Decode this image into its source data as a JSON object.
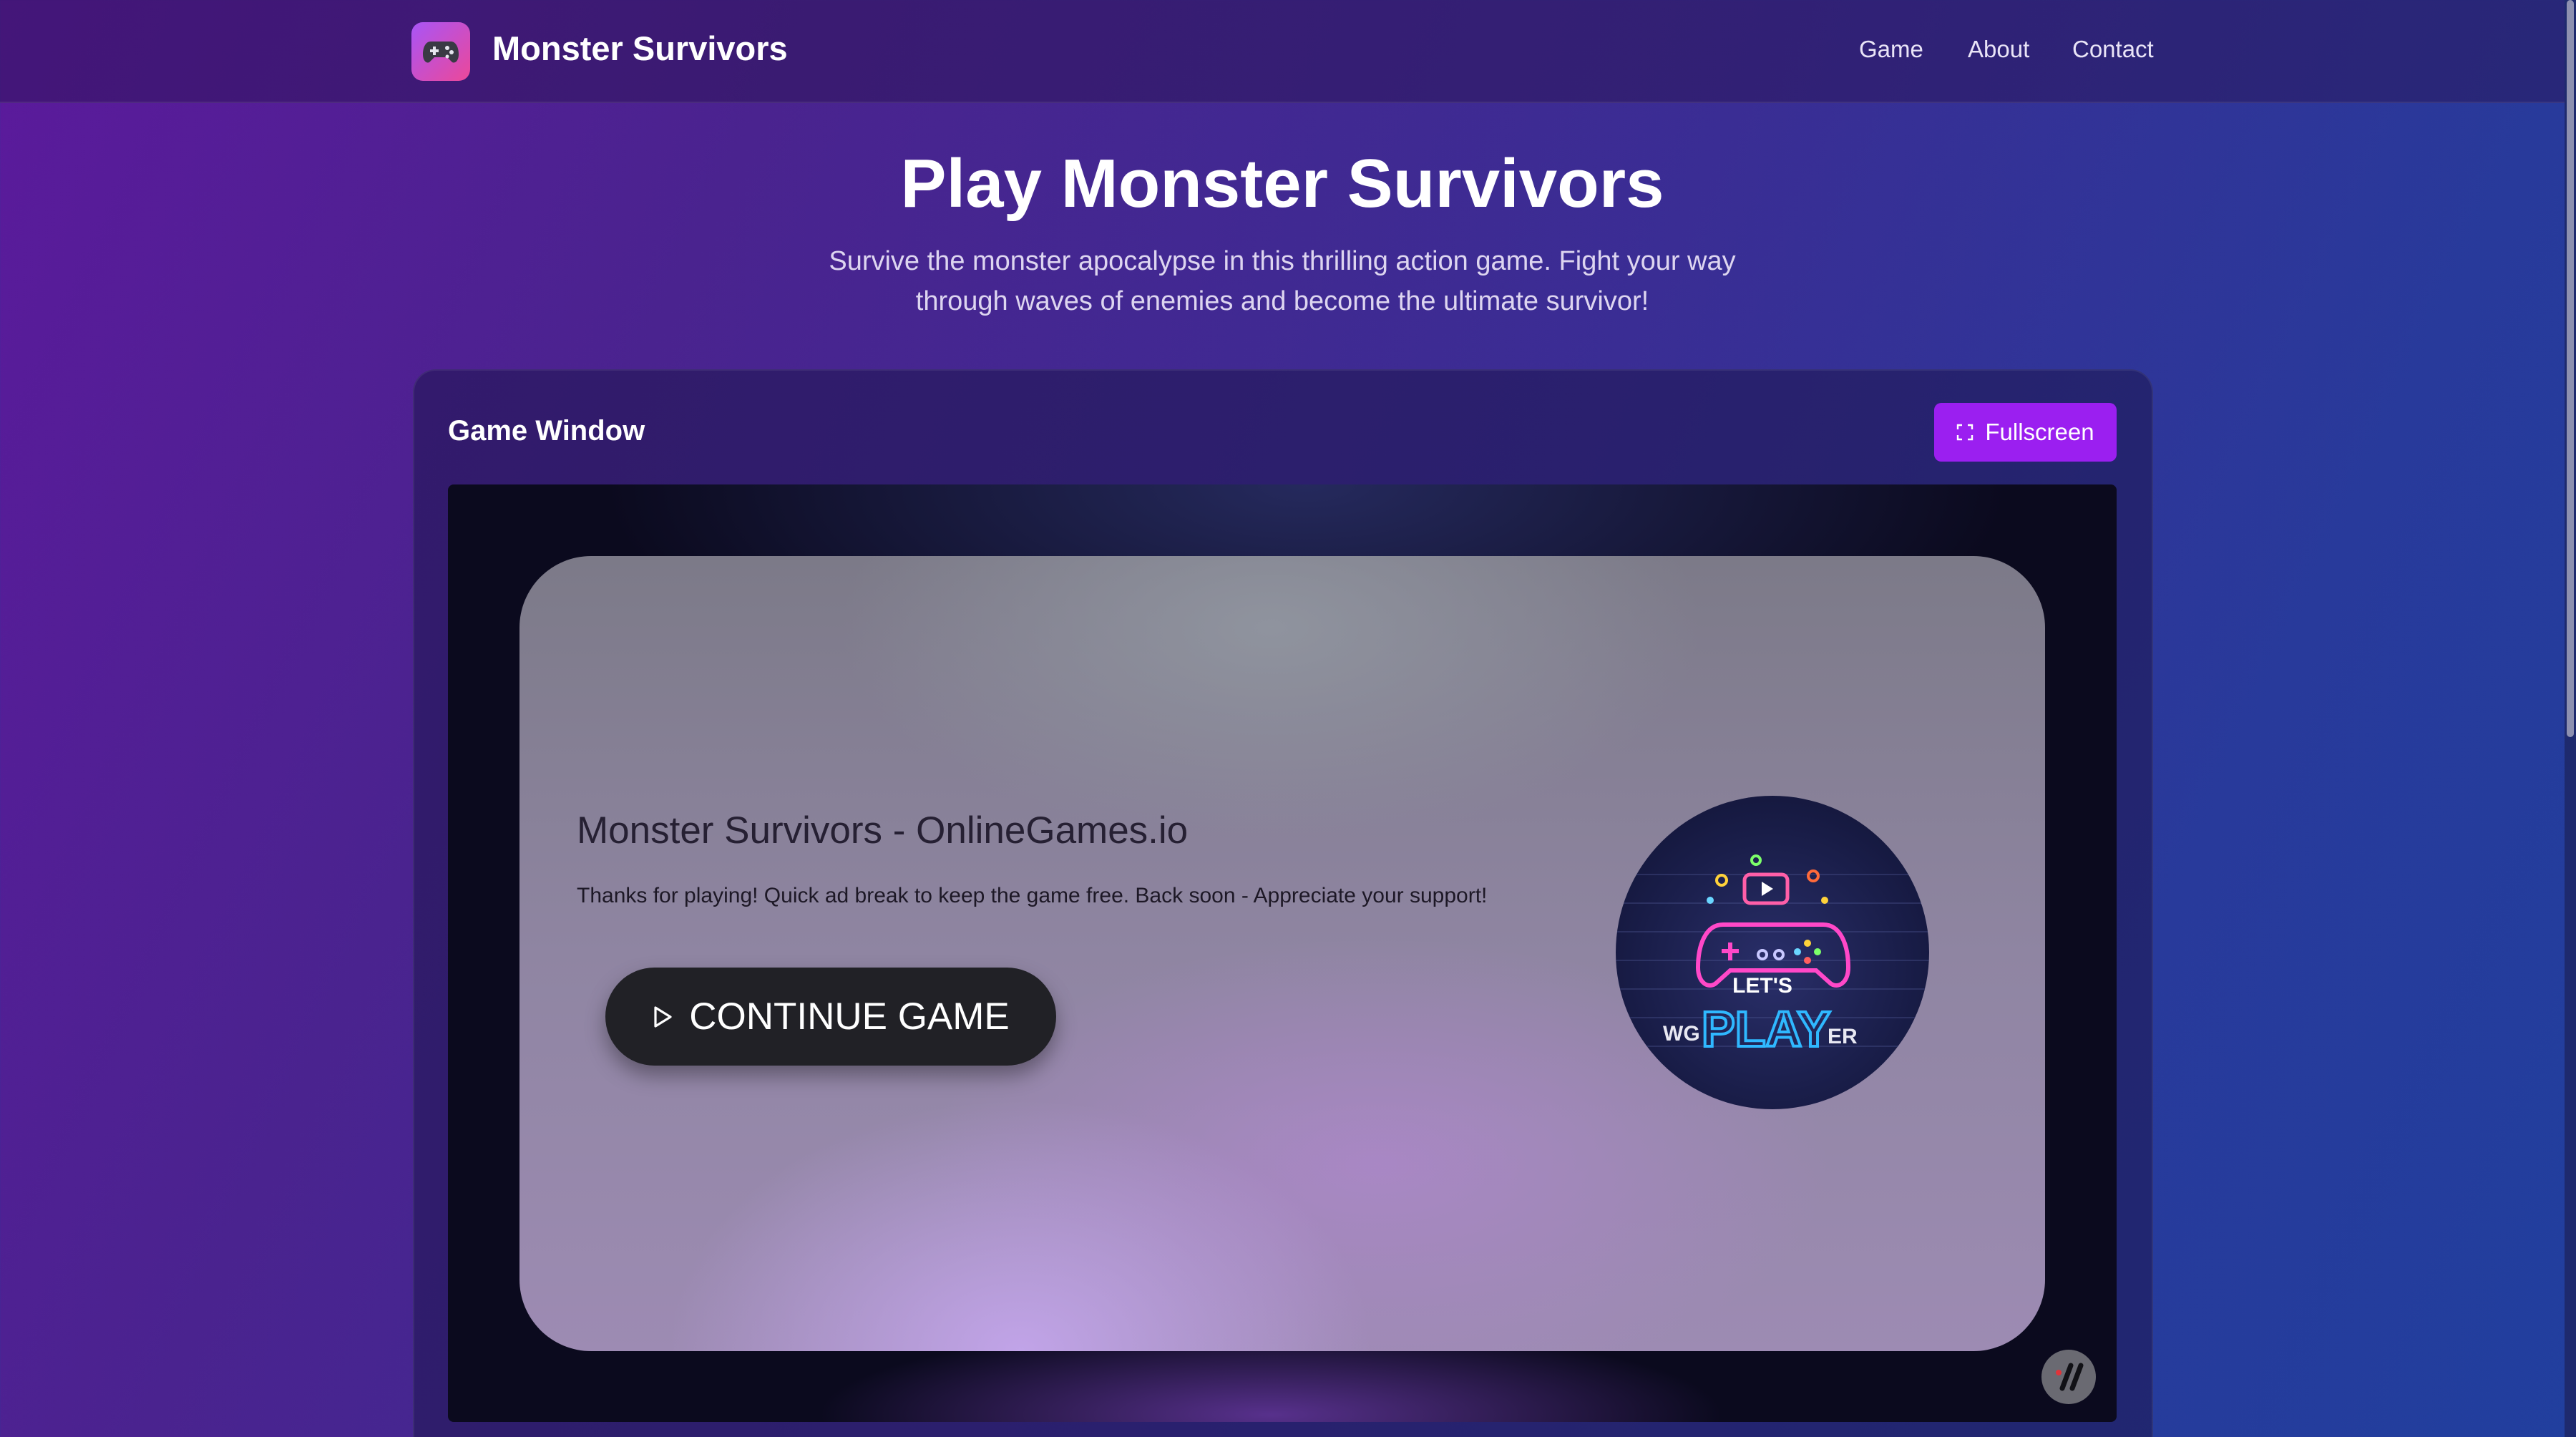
{
  "header": {
    "brand": "Monster Survivors",
    "logo_icon": "gamepad-icon",
    "nav": [
      {
        "label": "Game"
      },
      {
        "label": "About"
      },
      {
        "label": "Contact"
      }
    ]
  },
  "hero": {
    "title": "Play Monster Survivors",
    "subtitle": "Survive the monster apocalypse in this thrilling action game. Fight your way through waves of enemies and become the ultimate survivor!"
  },
  "panel": {
    "title": "Game Window",
    "fullscreen_label": "Fullscreen",
    "fullscreen_icon": "expand-icon"
  },
  "game": {
    "ad_title": "Monster Survivors - OnlineGames.io",
    "ad_text": "Thanks for playing! Quick ad break to keep the game free. Back soon - Appreciate your support!",
    "continue_label": "CONTINUE GAME",
    "continue_icon": "play-icon",
    "badge_icon": "neon-gamepad-badge"
  },
  "colors": {
    "accent": "#9b1ff0",
    "button_dark": "#212126",
    "bg_start": "#5b1a9c",
    "bg_end": "#213f9e"
  }
}
